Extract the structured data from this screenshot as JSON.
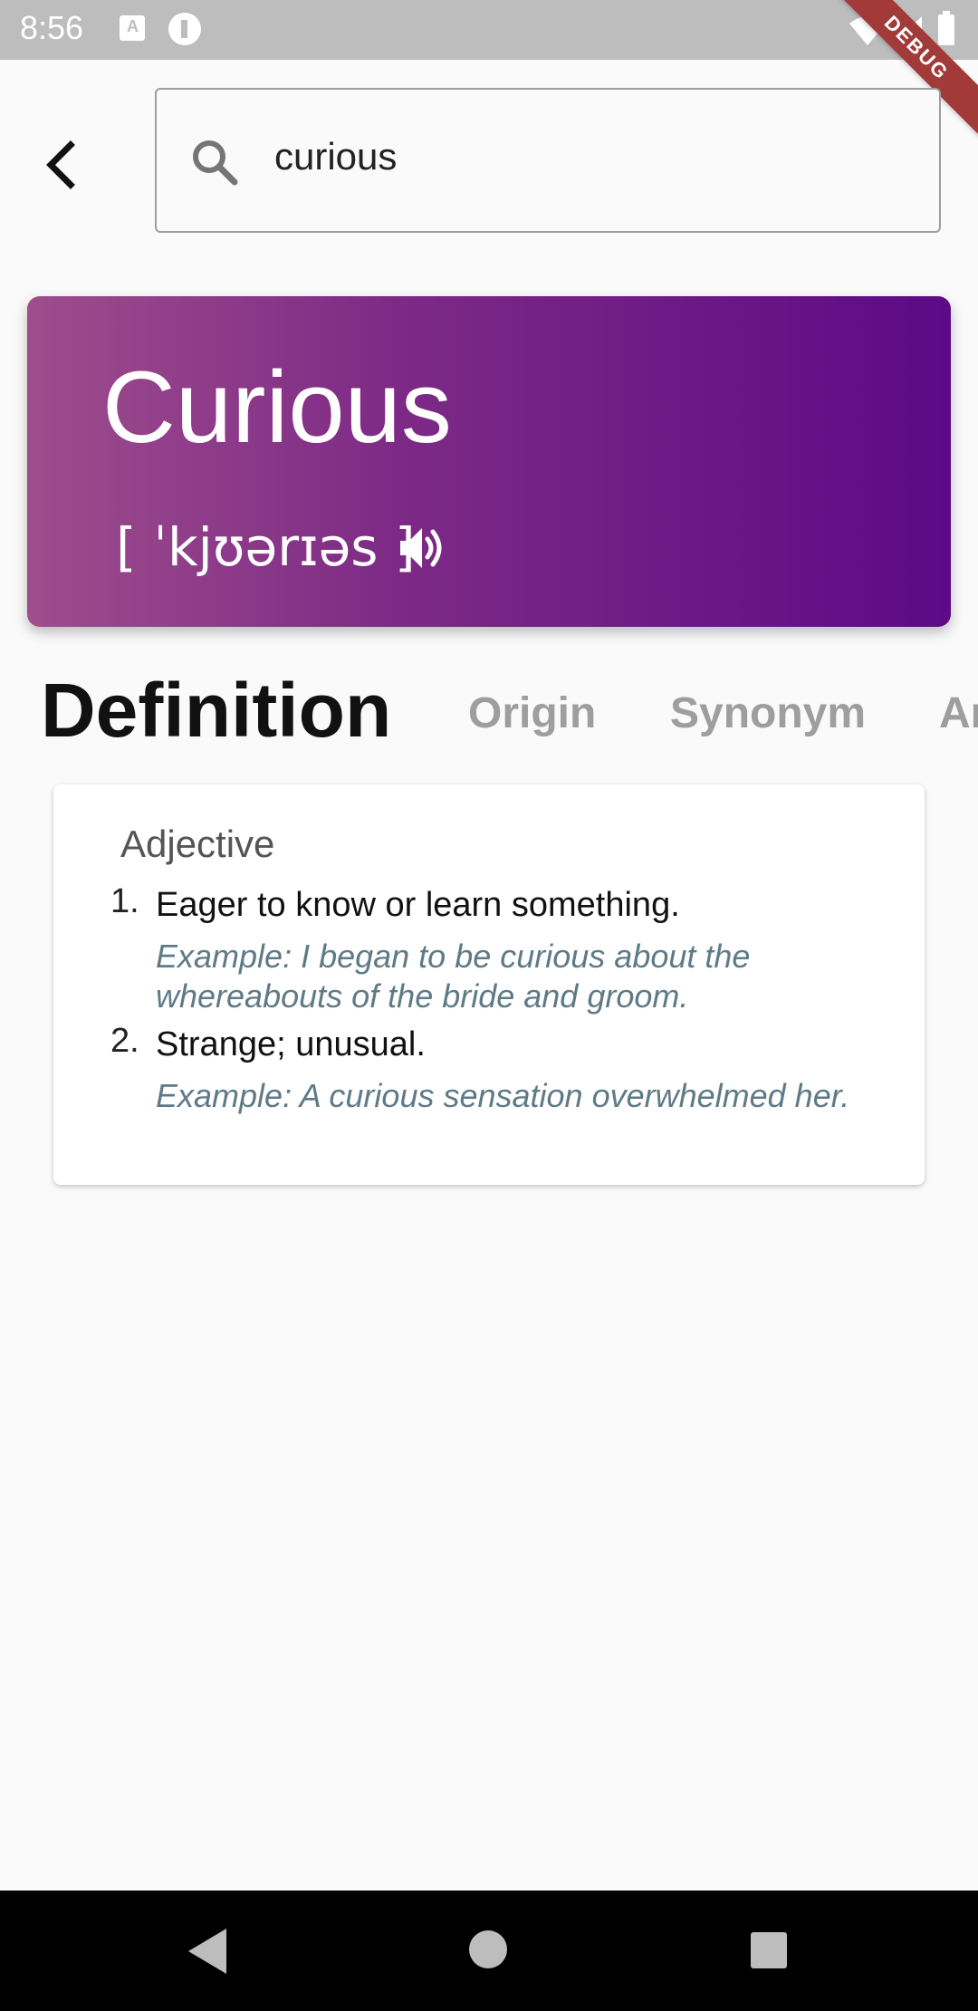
{
  "status_bar": {
    "time": "8:56",
    "icons": [
      "a-notification-icon",
      "app-notification-icon",
      "wifi-icon",
      "signal-icon",
      "battery-icon"
    ]
  },
  "debug_banner": "DEBUG",
  "search": {
    "value": "curious",
    "icon": "search-icon"
  },
  "word": {
    "title": "Curious",
    "pronunciation": "[ ˈkjʊərɪəs ]",
    "gradient_colors": [
      "#9e4d8c",
      "#5c0a86"
    ]
  },
  "tabs": [
    {
      "label": "Definition",
      "active": true
    },
    {
      "label": "Origin",
      "active": false
    },
    {
      "label": "Synonym",
      "active": false
    },
    {
      "label": "Ar",
      "active": false
    }
  ],
  "definition": {
    "part_of_speech": "Adjective",
    "items": [
      {
        "number": "1.",
        "text": "Eager to know or learn something.",
        "example": "Example: I began to be curious about the whereabouts of the bride and groom."
      },
      {
        "number": "2.",
        "text": "Strange; unusual.",
        "example": "Example: A curious sensation overwhelmed her."
      }
    ]
  },
  "colors": {
    "background": "#fafafa",
    "example_text": "#5f7a87",
    "tab_inactive": "#9e9e9e",
    "debug_banner": "#a33a3a"
  }
}
